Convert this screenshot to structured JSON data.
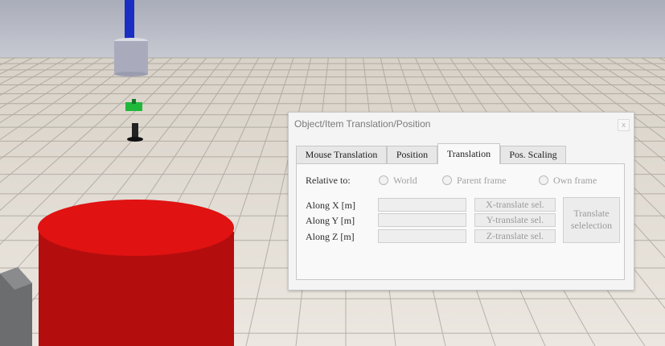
{
  "dialog": {
    "title": "Object/Item Translation/Position",
    "close_glyph": "x"
  },
  "tabs": [
    {
      "label": "Mouse Translation"
    },
    {
      "label": "Position"
    },
    {
      "label": "Translation"
    },
    {
      "label": "Pos. Scaling"
    }
  ],
  "active_tab": "Translation",
  "relative": {
    "label": "Relative to:",
    "options": [
      "World",
      "Parent frame",
      "Own frame"
    ]
  },
  "axes": [
    {
      "label": "Along X [m]",
      "value": "",
      "button": "X-translate sel."
    },
    {
      "label": "Along Y [m]",
      "value": "",
      "button": "Y-translate sel."
    },
    {
      "label": "Along Z [m]",
      "value": "",
      "button": "Z-translate sel."
    }
  ],
  "translate_button": {
    "line1": "Translate",
    "line2": "selelection"
  },
  "colors": {
    "sky": "#b9bcc7",
    "cylinder_red": "#dd1010",
    "arm_blue": "#1a2ec4",
    "floor_tile": "#e3ddd5"
  }
}
